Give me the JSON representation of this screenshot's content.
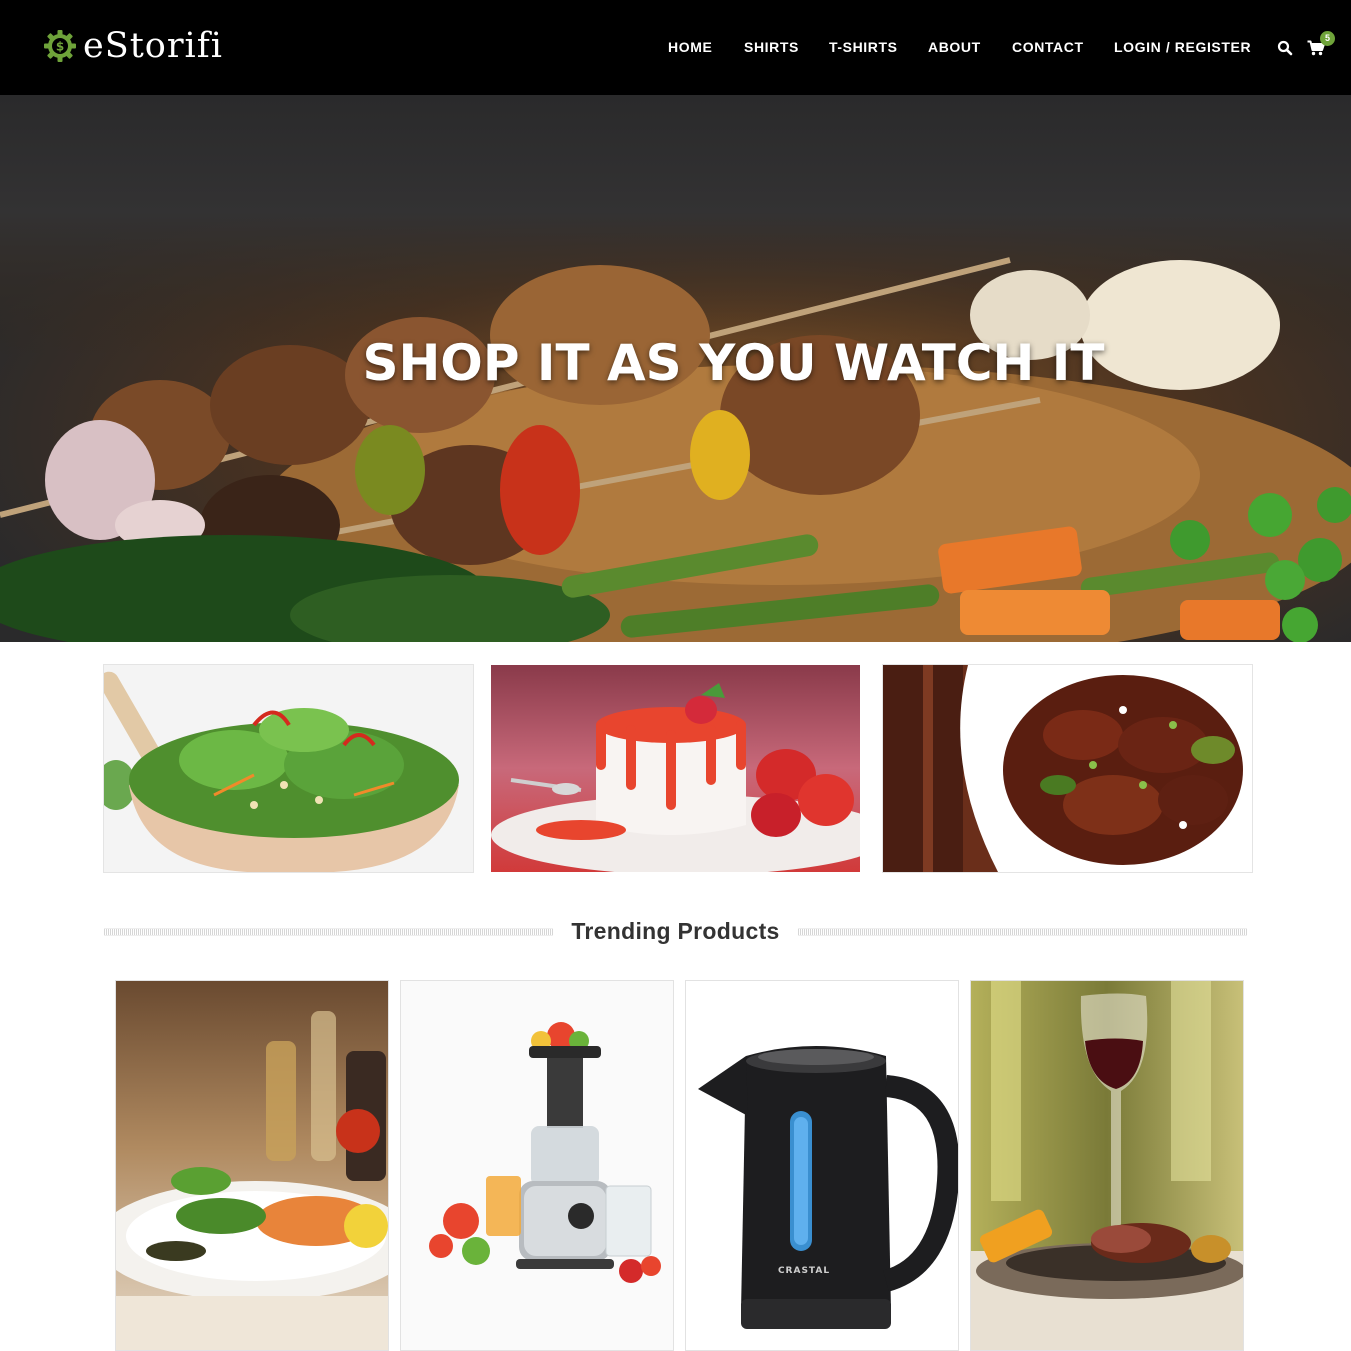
{
  "brand": {
    "name": "eStorifi",
    "logo_icon": "dollar-gear-icon",
    "accent_color": "#6fa33a"
  },
  "nav": {
    "items": [
      {
        "label": "HOME"
      },
      {
        "label": "SHIRTS"
      },
      {
        "label": "T-SHIRTS"
      },
      {
        "label": "ABOUT"
      },
      {
        "label": "CONTACT"
      },
      {
        "label": "LOGIN / REGISTER"
      }
    ],
    "search_icon": "search-icon",
    "cart_icon": "cart-icon",
    "cart_count": "5"
  },
  "hero": {
    "title": "SHOP IT AS YOU WATCH IT",
    "image": "sizzling-platter-photo"
  },
  "categories": [
    {
      "image": "salad-bowl-photo"
    },
    {
      "image": "panna-cotta-dessert-photo"
    },
    {
      "image": "chilli-chicken-photo"
    }
  ],
  "trending": {
    "title": "Trending Products",
    "products": [
      {
        "image": "salmon-dish-photo"
      },
      {
        "image": "juicer-photo"
      },
      {
        "image": "electric-kettle-photo",
        "brand_mark": "CRASTAL"
      },
      {
        "image": "wine-steak-photo"
      }
    ]
  },
  "colors": {
    "header_bg": "#000000",
    "page_bg": "#ffffff",
    "heading_text": "#333333"
  }
}
